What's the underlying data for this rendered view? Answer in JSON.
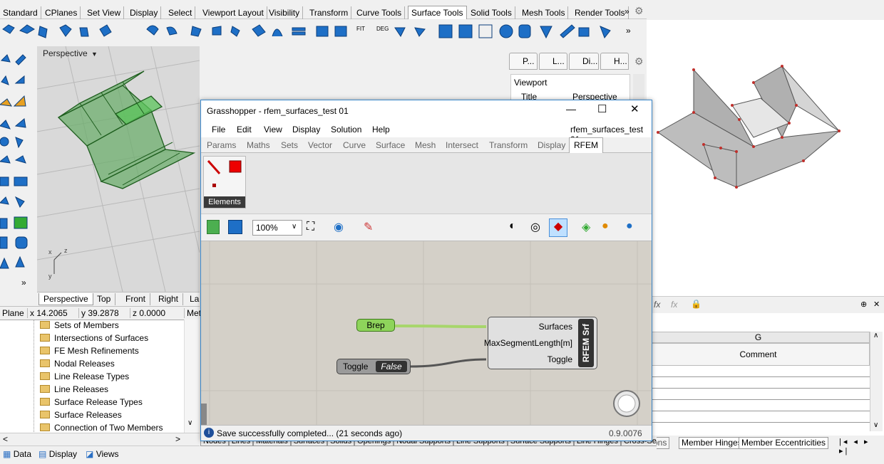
{
  "rhino": {
    "toolbar_tabs": [
      "Standard",
      "CPlanes",
      "Set View",
      "Display",
      "Select",
      "Viewport Layout",
      "Visibility",
      "Transform",
      "Curve Tools",
      "Surface Tools",
      "Solid Tools",
      "Mesh Tools",
      "Render Tools"
    ],
    "active_tab": "Surface Tools",
    "more": "»",
    "viewport": {
      "title": "Perspective",
      "tabs": [
        "Perspective",
        "Top",
        "Front",
        "Right",
        "La"
      ]
    },
    "axis": {
      "x": "x",
      "y": "y",
      "z": "z"
    },
    "status": {
      "plane": "Plane",
      "x": "x 14.2065",
      "y": "y 39.2878",
      "z": "z 0.0000",
      "units": "Met"
    },
    "properties": {
      "tabs": [
        "P...",
        "L...",
        "Di...",
        "H..."
      ],
      "section": "Viewport",
      "row_key": "Title",
      "row_val": "Perspective"
    }
  },
  "layers": {
    "items": [
      "Sets of Members",
      "Intersections of Surfaces",
      "FE Mesh Refinements",
      "Nodal Releases",
      "Line Release Types",
      "Line Releases",
      "Surface Release Types",
      "Surface Releases",
      "Connection of Two Members"
    ],
    "bottom_tabs": [
      "Data",
      "Display",
      "Views"
    ]
  },
  "grasshopper": {
    "title": "Grasshopper - rfem_surfaces_test 01",
    "doc_name": "rfem_surfaces_test 01",
    "menu": [
      "File",
      "Edit",
      "View",
      "Display",
      "Solution",
      "Help"
    ],
    "tabs": [
      "Params",
      "Maths",
      "Sets",
      "Vector",
      "Curve",
      "Surface",
      "Mesh",
      "Intersect",
      "Transform",
      "Display",
      "RFEM"
    ],
    "active_tab": "RFEM",
    "ribbon_group": "Elements",
    "zoom": "100%",
    "nodes": {
      "brep": "Brep",
      "toggle": "Toggle",
      "toggle_value": "False",
      "component_name": "RFEM Srf",
      "inputs": [
        "Surfaces",
        "MaxSegmentLength[m]",
        "Toggle"
      ]
    },
    "status": "Save successfully completed... (21 seconds ago)",
    "version": "0.9.0076"
  },
  "rfem": {
    "grid": {
      "column": "G",
      "header": "Comment"
    },
    "sheet_tabs": [
      "Nodes",
      "Lines",
      "Materials",
      "Surfaces",
      "Solids",
      "Openings",
      "Nodal Supports",
      "Line Supports",
      "Surface Supports",
      "Line Hinges",
      "Cross-Sections",
      "Member Hinges",
      "Member Eccentricities"
    ]
  }
}
